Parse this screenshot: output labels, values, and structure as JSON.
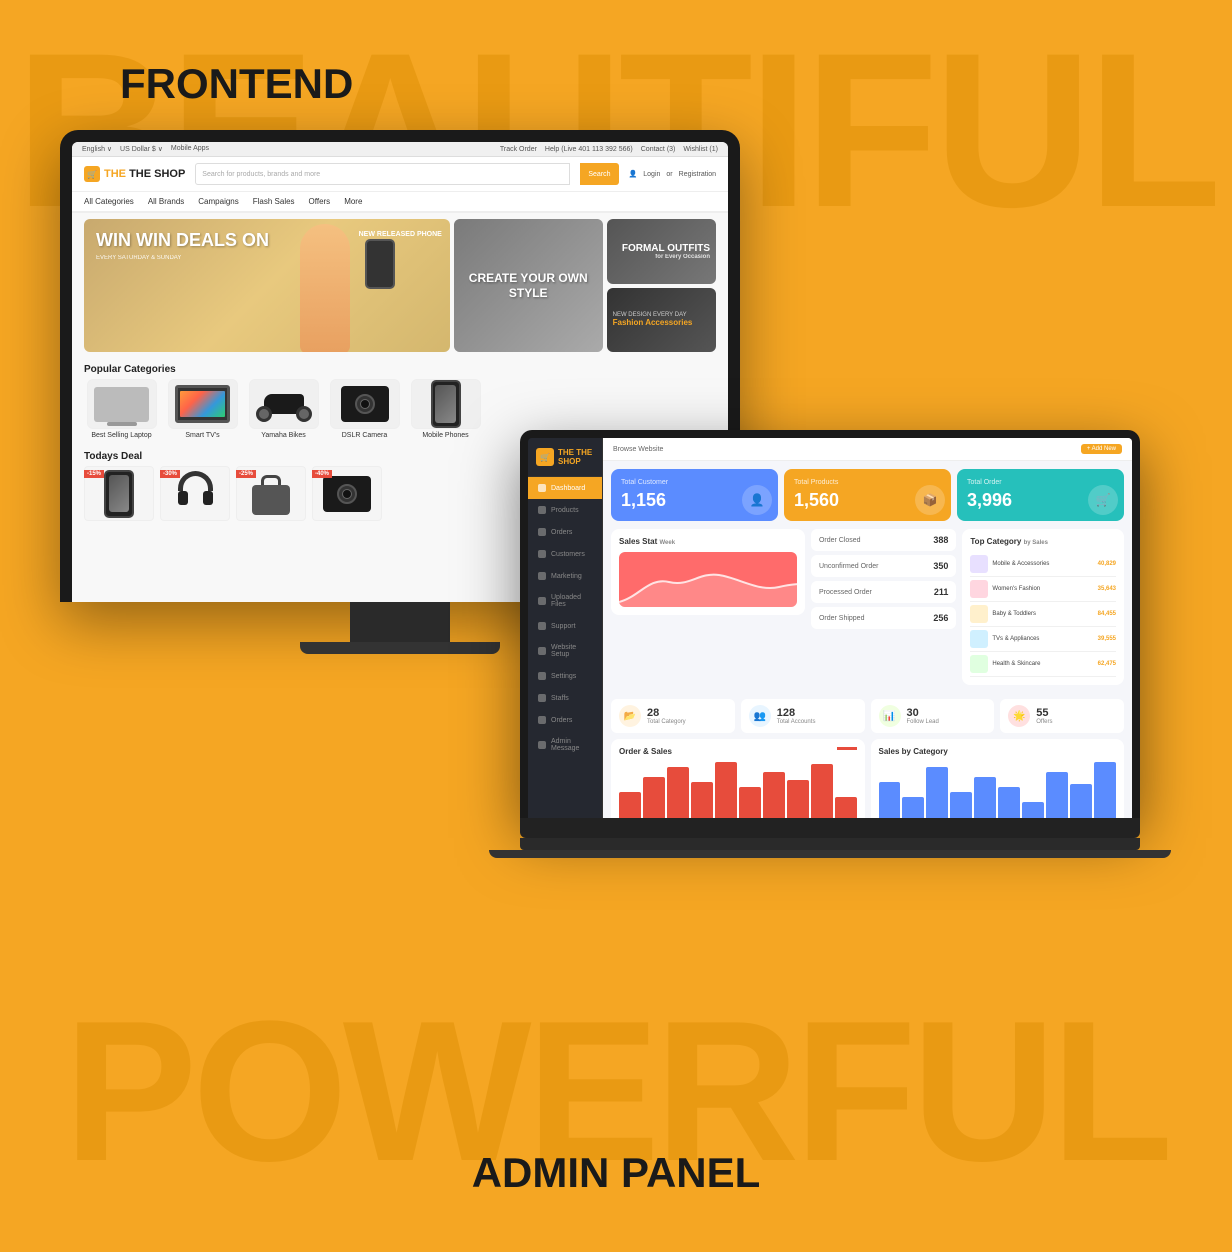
{
  "page": {
    "background_color": "#F5A623",
    "watermark_top": "BEAUTIFUL",
    "watermark_bottom": "POWERFUL",
    "label_frontend": "FRONTEND",
    "label_admin": "ADMIN PANEL"
  },
  "frontend": {
    "topbar": {
      "left": [
        "English ∨",
        "US Dollar $ ∨",
        "Mobile Apps"
      ],
      "right": [
        "Track Order",
        "Help (Live 401 113 392 566)",
        "Contact (3)",
        "Wishlist (1)"
      ]
    },
    "header": {
      "logo": "THE SHOP",
      "search_placeholder": "Search for products, brands and more",
      "search_button": "Search",
      "login": "Login",
      "or": "or",
      "register": "Registration"
    },
    "nav": {
      "items": [
        "All Categories",
        "All Brands",
        "Campaigns",
        "Flash Sales",
        "Offers",
        "More"
      ]
    },
    "banners": {
      "main_title": "WIN WIN DEALS ON",
      "main_sub": "EVERY SATURDAY & SUNDAY",
      "new_released": "NEW RELEASED PHONE",
      "style_title": "CREATE YOUR OWN STYLE",
      "formal_title": "FORMAL OUTFITS",
      "formal_sub": "for Every Occasion",
      "fashion_title": "Fashion Accessories",
      "fashion_pre": "NEW DESIGN EVERY DAY"
    },
    "categories": {
      "title": "Popular Categories",
      "items": [
        {
          "label": "Best Selling Laptop"
        },
        {
          "label": "Smart TV's"
        },
        {
          "label": "Yamaha Bikes"
        },
        {
          "label": "DSLR Camera"
        },
        {
          "label": "Mobile Phones"
        }
      ]
    },
    "deals": {
      "title": "Todays Deal",
      "badges": [
        "-15%",
        "-30%",
        "-25%",
        "-40%"
      ]
    }
  },
  "admin": {
    "logo": "THE SHOP",
    "topbar": {
      "website_label": "Browse Website",
      "add_btn": "+ Add New"
    },
    "nav_items": [
      {
        "label": "Dashboard",
        "active": true
      },
      {
        "label": "Products"
      },
      {
        "label": "Orders"
      },
      {
        "label": "Customers"
      },
      {
        "label": "Marketing"
      },
      {
        "label": "Uploaded Files"
      },
      {
        "label": "Support"
      },
      {
        "label": "Website Setup"
      },
      {
        "label": "Settings"
      },
      {
        "label": "Staffs"
      },
      {
        "label": "Orders"
      },
      {
        "label": "Admin Message"
      }
    ],
    "stats": [
      {
        "label": "Total Customer",
        "value": "1,156",
        "color": "blue"
      },
      {
        "label": "Total Products",
        "value": "1,560",
        "color": "orange"
      },
      {
        "label": "Total Order",
        "value": "3,996",
        "color": "teal"
      }
    ],
    "charts": {
      "sales_stat_title": "Sales Stat",
      "top_category_title": "Top Category",
      "by_label": "by Sales",
      "week_btn": "Week"
    },
    "orders": [
      {
        "label": "Order Closed",
        "value": "388"
      },
      {
        "label": "Unconfirmed Order",
        "value": "350"
      },
      {
        "label": "Processed Order",
        "value": "211"
      },
      {
        "label": "Order Shipped",
        "value": "256"
      }
    ],
    "top_categories": [
      {
        "name": "Mobile & Accessories",
        "sales": "40,829"
      },
      {
        "name": "Women's Fashion",
        "sales": "35,643"
      },
      {
        "name": "Baby & Toddlers",
        "sales": "84,455"
      },
      {
        "name": "TVs & Appliances",
        "sales": "39,555"
      },
      {
        "name": "Health & Skincare",
        "sales": "62,475"
      }
    ],
    "metrics": [
      {
        "value": "28",
        "label": "Total Category"
      },
      {
        "value": "128",
        "label": "Total Accounts"
      },
      {
        "value": "30",
        "label": "Follow Lead"
      },
      {
        "value": "55",
        "label": "Offers"
      }
    ],
    "bottom_charts": {
      "orders_sales_title": "Order & Sales",
      "sales_category_title": "Sales by Category"
    }
  }
}
